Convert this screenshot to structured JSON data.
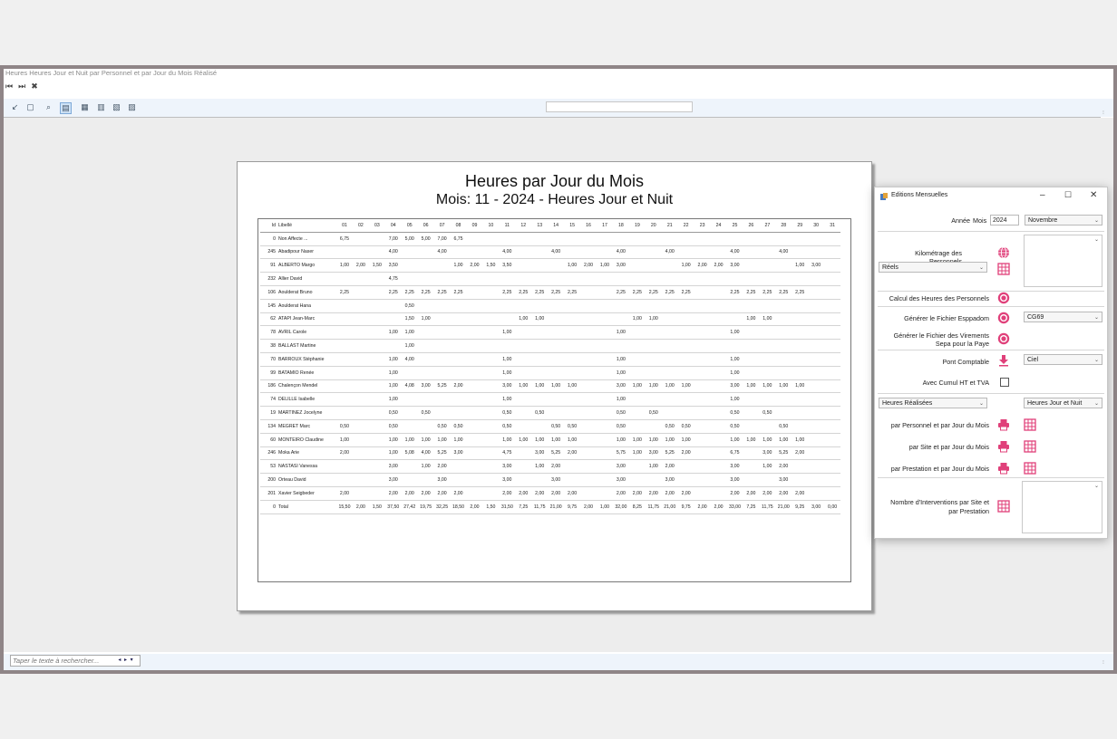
{
  "app": {
    "window_title": "Heures Heures Jour et Nuit par Personnel et par Jour du Mois Réalisé",
    "search_placeholder": "Taper le texte à rechercher..."
  },
  "report": {
    "title": "Heures par Jour du Mois",
    "subtitle": "Mois: 11 - 2024 - Heures Jour et Nuit",
    "headers": [
      "Id",
      "Libellé",
      "01",
      "02",
      "03",
      "04",
      "05",
      "06",
      "07",
      "08",
      "09",
      "10",
      "11",
      "12",
      "13",
      "14",
      "15",
      "16",
      "17",
      "18",
      "19",
      "20",
      "21",
      "22",
      "23",
      "24",
      "25",
      "26",
      "27",
      "28",
      "29",
      "30",
      "31"
    ],
    "rows": [
      [
        "0",
        "Non Affecte ...",
        "6,75",
        "",
        "",
        "7,00",
        "5,00",
        "5,00",
        "7,00",
        "6,75",
        "",
        "",
        "",
        "",
        "",
        "",
        "",
        "",
        "",
        "",
        "",
        "",
        "",
        "",
        "",
        "",
        "",
        "",
        "",
        "",
        "",
        "",
        ""
      ],
      [
        "245",
        "Abadipour Naser",
        "",
        "",
        "",
        "4,00",
        "",
        "",
        "4,00",
        "",
        "",
        "",
        "4,00",
        "",
        "",
        "4,00",
        "",
        "",
        "",
        "4,00",
        "",
        "",
        "4,00",
        "",
        "",
        "",
        "4,00",
        "",
        "",
        "4,00",
        "",
        "",
        ""
      ],
      [
        "91",
        "ALBERTO Margo",
        "1,00",
        "2,00",
        "1,50",
        "3,50",
        "",
        "",
        "",
        "1,00",
        "2,00",
        "1,50",
        "3,50",
        "",
        "",
        "",
        "1,00",
        "2,00",
        "1,00",
        "3,00",
        "",
        "",
        "",
        "1,00",
        "2,00",
        "2,00",
        "3,00",
        "",
        "",
        "",
        "1,00",
        "3,00",
        ""
      ],
      [
        "232",
        "Allier David",
        "",
        "",
        "",
        "4,75",
        "",
        "",
        "",
        "",
        "",
        "",
        "",
        "",
        "",
        "",
        "",
        "",
        "",
        "",
        "",
        "",
        "",
        "",
        "",
        "",
        "",
        "",
        "",
        "",
        "",
        "",
        ""
      ],
      [
        "106",
        "Aoulderat Bruno",
        "2,25",
        "",
        "",
        "2,25",
        "2,25",
        "2,25",
        "2,25",
        "2,25",
        "",
        "",
        "2,25",
        "2,25",
        "2,25",
        "2,25",
        "2,25",
        "",
        "",
        "2,25",
        "2,25",
        "2,25",
        "2,25",
        "2,25",
        "",
        "",
        "2,25",
        "2,25",
        "2,25",
        "2,25",
        "2,25",
        "",
        ""
      ],
      [
        "145",
        "Aoulderat Hana",
        "",
        "",
        "",
        "",
        "0,50",
        "",
        "",
        "",
        "",
        "",
        "",
        "",
        "",
        "",
        "",
        "",
        "",
        "",
        "",
        "",
        "",
        "",
        "",
        "",
        "",
        "",
        "",
        "",
        "",
        "",
        ""
      ],
      [
        "62",
        "ATAPI Jean-Marc",
        "",
        "",
        "",
        "",
        "1,50",
        "1,00",
        "",
        "",
        "",
        "",
        "",
        "1,00",
        "1,00",
        "",
        "",
        "",
        "",
        "",
        "1,00",
        "1,00",
        "",
        "",
        "",
        "",
        "",
        "1,00",
        "1,00",
        "",
        "",
        "",
        ""
      ],
      [
        "78",
        "AVRIL Carole",
        "",
        "",
        "",
        "1,00",
        "1,00",
        "",
        "",
        "",
        "",
        "",
        "1,00",
        "",
        "",
        "",
        "",
        "",
        "",
        "1,00",
        "",
        "",
        "",
        "",
        "",
        "",
        "1,00",
        "",
        "",
        "",
        "",
        "",
        ""
      ],
      [
        "38",
        "BALLAST Martine",
        "",
        "",
        "",
        "",
        "1,00",
        "",
        "",
        "",
        "",
        "",
        "",
        "",
        "",
        "",
        "",
        "",
        "",
        "",
        "",
        "",
        "",
        "",
        "",
        "",
        "",
        "",
        "",
        "",
        "",
        "",
        ""
      ],
      [
        "70",
        "BARROUX Stéphanie",
        "",
        "",
        "",
        "1,00",
        "4,00",
        "",
        "",
        "",
        "",
        "",
        "1,00",
        "",
        "",
        "",
        "",
        "",
        "",
        "1,00",
        "",
        "",
        "",
        "",
        "",
        "",
        "1,00",
        "",
        "",
        "",
        "",
        "",
        ""
      ],
      [
        "99",
        "BATAMIO Renée",
        "",
        "",
        "",
        "1,00",
        "",
        "",
        "",
        "",
        "",
        "",
        "1,00",
        "",
        "",
        "",
        "",
        "",
        "",
        "1,00",
        "",
        "",
        "",
        "",
        "",
        "",
        "1,00",
        "",
        "",
        "",
        "",
        "",
        ""
      ],
      [
        "186",
        "Chalençon Mendel",
        "",
        "",
        "",
        "1,00",
        "4,08",
        "3,00",
        "5,25",
        "2,00",
        "",
        "",
        "3,00",
        "1,00",
        "1,00",
        "1,00",
        "1,00",
        "",
        "",
        "3,00",
        "1,00",
        "1,00",
        "1,00",
        "1,00",
        "",
        "",
        "3,00",
        "1,00",
        "1,00",
        "1,00",
        "1,00",
        "",
        ""
      ],
      [
        "74",
        "DELILLE Isabelle",
        "",
        "",
        "",
        "1,00",
        "",
        "",
        "",
        "",
        "",
        "",
        "1,00",
        "",
        "",
        "",
        "",
        "",
        "",
        "1,00",
        "",
        "",
        "",
        "",
        "",
        "",
        "1,00",
        "",
        "",
        "",
        "",
        "",
        ""
      ],
      [
        "19",
        "MARTINEZ Jocelyne",
        "",
        "",
        "",
        "0,50",
        "",
        "0,50",
        "",
        "",
        "",
        "",
        "0,50",
        "",
        "0,50",
        "",
        "",
        "",
        "",
        "0,50",
        "",
        "0,50",
        "",
        "",
        "",
        "",
        "0,50",
        "",
        "0,50",
        "",
        "",
        "",
        ""
      ],
      [
        "134",
        "MEGRET Marc",
        "0,50",
        "",
        "",
        "0,50",
        "",
        "",
        "0,50",
        "0,50",
        "",
        "",
        "0,50",
        "",
        "",
        "0,50",
        "0,50",
        "",
        "",
        "0,50",
        "",
        "",
        "0,50",
        "0,50",
        "",
        "",
        "0,50",
        "",
        "",
        "0,50",
        "",
        "",
        ""
      ],
      [
        "60",
        "MONTEIRO Claudine",
        "1,00",
        "",
        "",
        "1,00",
        "1,00",
        "1,00",
        "1,00",
        "1,00",
        "",
        "",
        "1,00",
        "1,00",
        "1,00",
        "1,00",
        "1,00",
        "",
        "",
        "1,00",
        "1,00",
        "1,00",
        "1,00",
        "1,00",
        "",
        "",
        "1,00",
        "1,00",
        "1,00",
        "1,00",
        "1,00",
        "",
        ""
      ],
      [
        "246",
        "Moka Arie",
        "2,00",
        "",
        "",
        "1,00",
        "5,08",
        "4,00",
        "5,25",
        "3,00",
        "",
        "",
        "4,75",
        "",
        "3,00",
        "5,25",
        "2,00",
        "",
        "",
        "5,75",
        "1,00",
        "3,00",
        "5,25",
        "2,00",
        "",
        "",
        "6,75",
        "",
        "3,00",
        "5,25",
        "2,00",
        "",
        ""
      ],
      [
        "53",
        "NASTASI Vanessa",
        "",
        "",
        "",
        "3,00",
        "",
        "1,00",
        "2,00",
        "",
        "",
        "",
        "3,00",
        "",
        "1,00",
        "2,00",
        "",
        "",
        "",
        "3,00",
        "",
        "1,00",
        "2,00",
        "",
        "",
        "",
        "3,00",
        "",
        "1,00",
        "2,00",
        "",
        "",
        ""
      ],
      [
        "200",
        "Orteau David",
        "",
        "",
        "",
        "3,00",
        "",
        "",
        "3,00",
        "",
        "",
        "",
        "3,00",
        "",
        "",
        "3,00",
        "",
        "",
        "",
        "3,00",
        "",
        "",
        "3,00",
        "",
        "",
        "",
        "3,00",
        "",
        "",
        "3,00",
        "",
        "",
        ""
      ],
      [
        "201",
        "Xavier Seigbeder",
        "2,00",
        "",
        "",
        "2,00",
        "2,00",
        "2,00",
        "2,00",
        "2,00",
        "",
        "",
        "2,00",
        "2,00",
        "2,00",
        "2,00",
        "2,00",
        "",
        "",
        "2,00",
        "2,00",
        "2,00",
        "2,00",
        "2,00",
        "",
        "",
        "2,00",
        "2,00",
        "2,00",
        "2,00",
        "2,00",
        "",
        ""
      ],
      [
        "0",
        "Total",
        "15,50",
        "2,00",
        "1,50",
        "37,50",
        "27,42",
        "19,75",
        "32,25",
        "18,50",
        "2,00",
        "1,50",
        "31,50",
        "7,25",
        "11,75",
        "21,00",
        "9,75",
        "2,00",
        "1,00",
        "32,00",
        "8,25",
        "11,75",
        "21,00",
        "9,75",
        "2,00",
        "2,00",
        "33,00",
        "7,25",
        "11,75",
        "21,00",
        "9,25",
        "3,00",
        "0,00"
      ]
    ]
  },
  "dialog": {
    "title": "Editions Mensuelles",
    "annee_label": "Année",
    "mois_label": "Mois",
    "annee_value": "2024",
    "mois_value": "Novembre",
    "kilometrage_label": "Kilométrage des Personnels",
    "reels_value": "Réels",
    "calcul_label": "Calcul des Heures des Personnels",
    "esppadom_label": "Générer le Fichier Esppadom",
    "esppadom_value": "CG69",
    "sepa_label_1": "Générer le Fichier des Virements",
    "sepa_label_2": "Sepa pour la Paye",
    "pont_label": "Pont Comptable",
    "pont_value": "Ciel",
    "cumul_label": "Avec Cumul HT et TVA",
    "heures_type_value": "Heures Réalisées",
    "heures_mode_value": "Heures Jour et Nuit",
    "par_personnel_label": "par Personnel et par Jour du Mois",
    "par_site_label": "par Site et par Jour du Mois",
    "par_prestation_label": "par Prestation et par Jour du Mois",
    "interventions_label_1": "Nombre d'Interventions par Site et",
    "interventions_label_2": "par Prestation"
  },
  "colors": {
    "accent_pink": "#e0407a",
    "toolbar_bg": "#eef4fb",
    "frame": "#8f8587"
  }
}
